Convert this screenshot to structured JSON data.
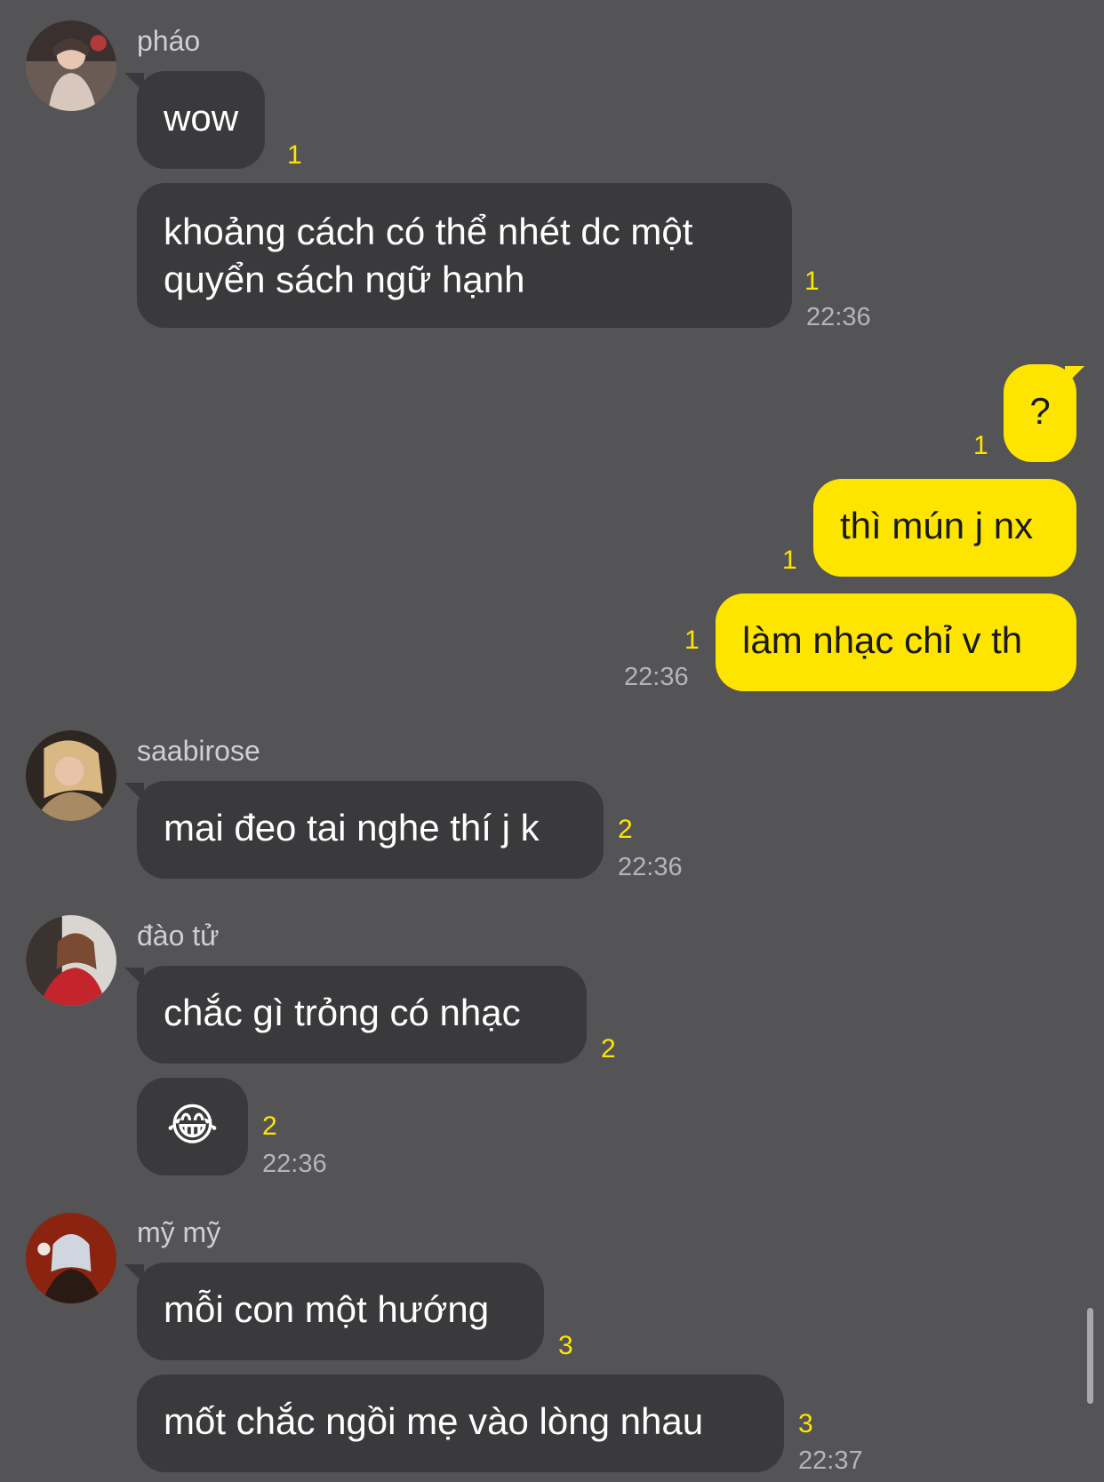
{
  "messages": {
    "m1": {
      "sender": "pháo",
      "text": "wow",
      "unread": "1"
    },
    "m2": {
      "text": "khoảng cách có thể nhét dc một quyển sách ngữ hạnh",
      "unread": "1",
      "time": "22:36"
    },
    "m3": {
      "text": "?",
      "unread": "1"
    },
    "m4": {
      "text": "thì mún j nx",
      "unread": "1"
    },
    "m5": {
      "text": "làm nhạc chỉ v th",
      "unread": "1",
      "time": "22:36"
    },
    "m6": {
      "sender": "saabirose",
      "text": "mai đeo tai nghe thí j k",
      "unread": "2",
      "time": "22:36"
    },
    "m7": {
      "sender": "đào tử",
      "text": "chắc gì trỏng có nhạc",
      "unread": "2"
    },
    "m8": {
      "text": "😂",
      "unread": "2",
      "time": "22:36"
    },
    "m9": {
      "sender": "mỹ mỹ",
      "text": "mỗi con một hướng",
      "unread": "3"
    },
    "m10": {
      "text": "mốt chắc ngồi mẹ vào lòng nhau",
      "unread": "3",
      "time": "22:37"
    }
  },
  "colors": {
    "background": "#545456",
    "incoming_bubble": "#3a3a3c",
    "outgoing_bubble": "#fee500",
    "unread_count": "#fee500"
  }
}
